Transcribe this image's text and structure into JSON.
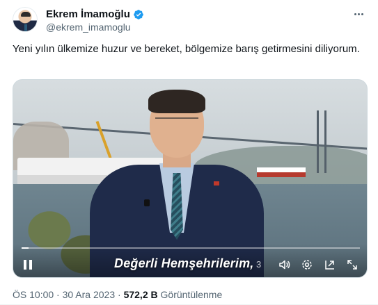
{
  "author": {
    "display_name": "Ekrem İmamoğlu",
    "handle": "@ekrem_imamoglu",
    "verified": true
  },
  "icons": {
    "verified": "verified-badge-icon",
    "more": "more-options-icon",
    "pause": "pause-icon",
    "volume": "volume-icon",
    "settings": "gear-icon",
    "picture_in_picture": "pip-icon",
    "fullscreen": "fullscreen-icon"
  },
  "tweet": {
    "text": "Yeni yılın ülkemize huzur ve bereket, bölgemize barış getirmesini diliyorum."
  },
  "video": {
    "caption": "Değerli Hemşehrilerim,",
    "time_fragment": "3",
    "progress": 0.02
  },
  "meta": {
    "time": "ÖS 10:00",
    "separator": "·",
    "date": "30 Ara 2023",
    "views_count": "572,2 B",
    "views_label": "Görüntülenme"
  },
  "colors": {
    "verified_blue": "#1d9bf0",
    "text_primary": "#0f1419",
    "text_secondary": "#536471"
  }
}
